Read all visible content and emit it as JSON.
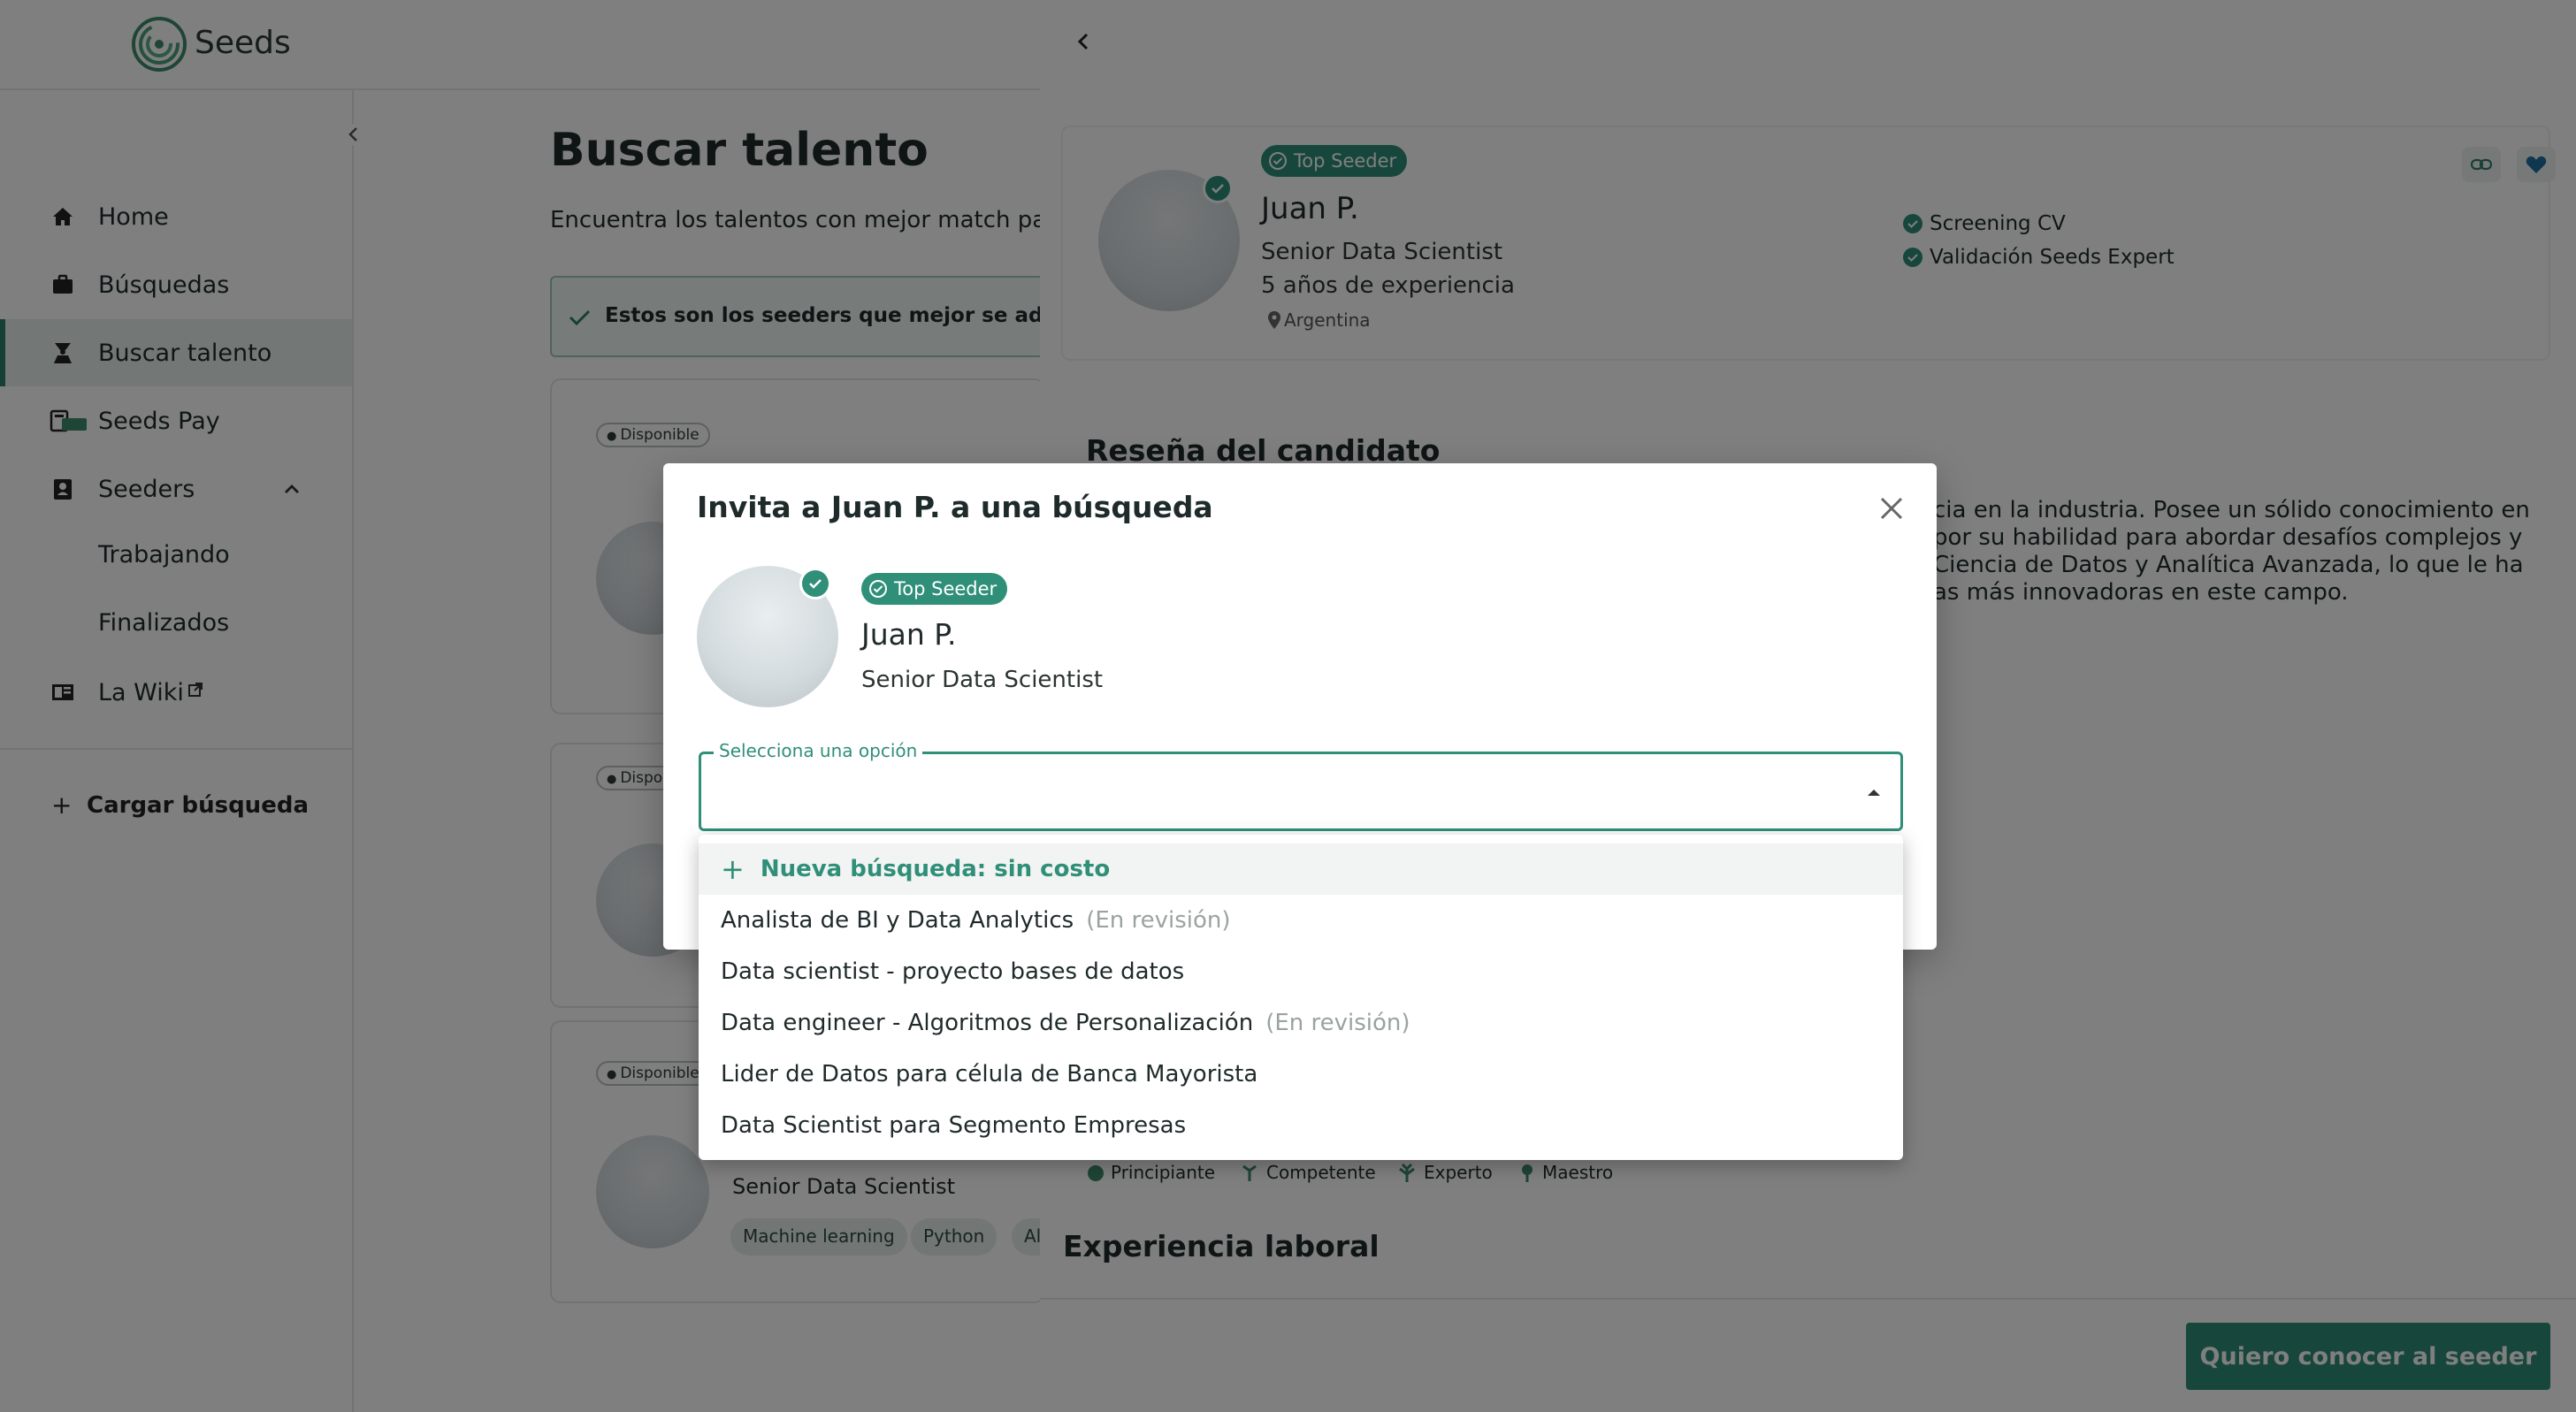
{
  "app": {
    "name": "Seeds"
  },
  "sidebar": {
    "items": [
      {
        "label": "Home",
        "icon": "home-icon"
      },
      {
        "label": "Búsquedas",
        "icon": "briefcase-icon"
      },
      {
        "label": "Buscar talento",
        "icon": "talent-icon",
        "active": true
      },
      {
        "label": "Seeds Pay",
        "icon": "payment-icon"
      },
      {
        "label": "Seeders",
        "icon": "badge-icon"
      },
      {
        "label": "La Wiki",
        "icon": "book-icon"
      }
    ],
    "seeders_subitems": [
      "Trabajando",
      "Finalizados"
    ],
    "add_search_label": "Cargar búsqueda"
  },
  "main": {
    "title": "Buscar talento",
    "subtitle": "Encuentra los talentos con mejor match pa",
    "info_banner": "Estos son los seeders que mejor se adecua",
    "cards": [
      {
        "status": "Disponible"
      },
      {
        "status": "Dispo"
      },
      {
        "status": "Disponible",
        "role": "Senior Data Scientist",
        "skills": [
          "Machine learning",
          "Python",
          "Al"
        ]
      }
    ]
  },
  "profile": {
    "badge": "Top Seeder",
    "name": "Juan P.",
    "role": "Senior Data Scientist",
    "experience": "5 años de experiencia",
    "location": "Argentina",
    "validations": [
      "Screening CV",
      "Validación Seeds Expert"
    ],
    "review_title": "Reseña del candidato",
    "review_lines": [
      "cia en la industria. Posee un sólido conocimiento en",
      "por su habilidad para abordar desafíos complejos y",
      "Ciencia de Datos y Analítica Avanzada, lo que le ha",
      "as más innovadoras en este campo."
    ],
    "levels": [
      "Principiante",
      "Competente",
      "Experto",
      "Maestro"
    ],
    "experience_title": "Experiencia laboral",
    "cta_label": "Quiero conocer al seeder"
  },
  "modal": {
    "title": "Invita a Juan P. a una búsqueda",
    "badge": "Top Seeder",
    "name": "Juan P.",
    "role": "Senior Data Scientist",
    "select_label": "Selecciona una opción",
    "options": [
      {
        "label": "Nueva búsqueda: sin costo",
        "tag": ""
      },
      {
        "label": "Analista de BI y Data Analytics",
        "tag": "(En revisión)"
      },
      {
        "label": "Data scientist - proyecto bases de datos",
        "tag": ""
      },
      {
        "label": "Data engineer - Algoritmos de Personalización",
        "tag": "(En revisión)"
      },
      {
        "label": "Lider de Datos para célula de Banca Mayorista",
        "tag": ""
      },
      {
        "label": "Data Scientist para Segmento Empresas",
        "tag": ""
      }
    ]
  },
  "colors": {
    "primary": "#2f8f78",
    "dark_primary": "#2f7f6d",
    "backdrop": "rgba(0,0,0,0.5)"
  }
}
